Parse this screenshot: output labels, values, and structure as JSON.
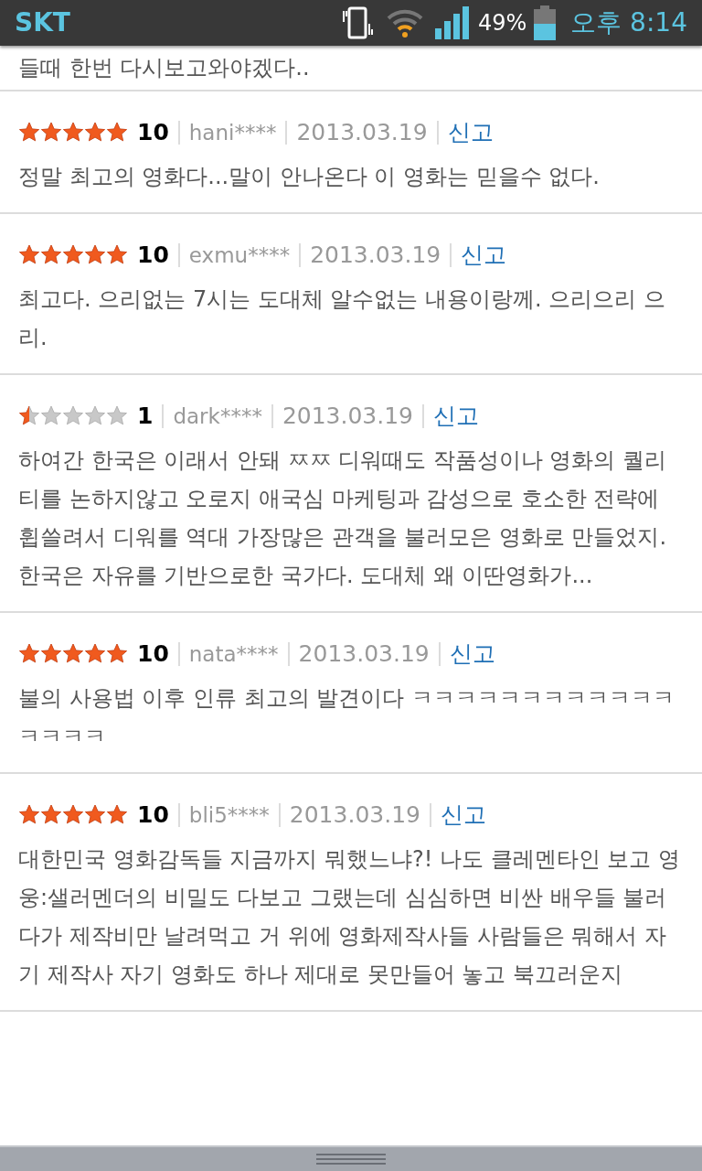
{
  "status_bar": {
    "carrier": "SKT",
    "battery": "49%",
    "time": "오후 8:14"
  },
  "partial_text": "들때 한번 다시보고와야겠다..",
  "reviews": [
    {
      "stars": 5,
      "score": "10",
      "user": "hani****",
      "date": "2013.03.19",
      "report": "신고",
      "text": "정말 최고의 영화다...말이 안나온다 이 영화는 믿을수 없다."
    },
    {
      "stars": 5,
      "score": "10",
      "user": "exmu****",
      "date": "2013.03.19",
      "report": "신고",
      "text": "최고다. 으리없는 7시는 도대체 알수없는 내용이랑께. 으리으리 으리."
    },
    {
      "stars": 0.5,
      "score": "1",
      "user": "dark****",
      "date": "2013.03.19",
      "report": "신고",
      "text": "하여간 한국은 이래서 안돼 ㅉㅉ 디워때도 작품성이나 영화의 퀄리티를 논하지않고 오로지 애국심 마케팅과 감성으로 호소한 전략에 휩쓸려서 디워를 역대 가장많은 관객을 불러모은 영화로 만들었지. 한국은 자유를 기반으로한 국가다. 도대체 왜 이딴영화가..."
    },
    {
      "stars": 5,
      "score": "10",
      "user": "nata****",
      "date": "2013.03.19",
      "report": "신고",
      "text": "불의 사용법 이후 인류 최고의 발견이다 ㅋㅋㅋㅋㅋㅋㅋㅋㅋㅋㅋㅋㅋㅋㅋㅋ"
    },
    {
      "stars": 5,
      "score": "10",
      "user": "bli5****",
      "date": "2013.03.19",
      "report": "신고",
      "text": "대한민국 영화감독들 지금까지 뭐했느냐?! 나도 클레멘타인 보고 영웅:샐러멘더의 비밀도 다보고 그랬는데 심심하면 비싼 배우들 불러다가 제작비만 날려먹고 거 위에 영화제작사들 사람들은 뭐해서 자기 제작사 자기 영화도 하나 제대로 못만들어 놓고 북끄러운지"
    }
  ]
}
